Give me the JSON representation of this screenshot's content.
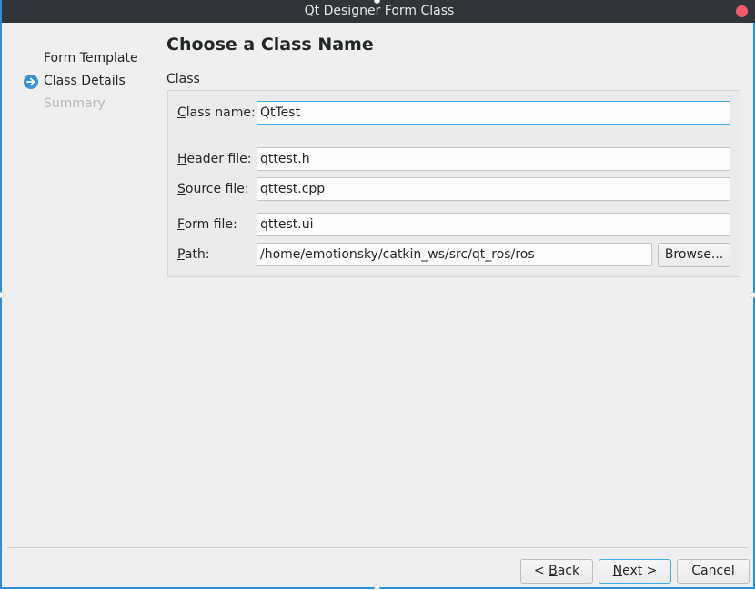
{
  "window": {
    "title": "Qt Designer Form Class"
  },
  "nav": {
    "items": [
      {
        "label": "Form Template",
        "state": "done"
      },
      {
        "label": "Class Details",
        "state": "current"
      },
      {
        "label": "Summary",
        "state": "pending"
      }
    ],
    "current_icon": "arrow-right-circle-icon"
  },
  "page": {
    "title": "Choose a Class Name",
    "group_title": "Class"
  },
  "form": {
    "class_name": {
      "label_mn": "C",
      "label_rest": "lass name:",
      "value": "QtTest"
    },
    "header_file": {
      "label_mn": "H",
      "label_rest": "eader file:",
      "value": "qttest.h"
    },
    "source_file": {
      "label_mn": "S",
      "label_rest": "ource file:",
      "value": "qttest.cpp"
    },
    "form_file": {
      "label_mn": "F",
      "label_rest": "orm file:",
      "value": "qttest.ui"
    },
    "path": {
      "label_mn": "P",
      "label_rest": "ath:",
      "value": "/home/emotionsky/catkin_ws/src/qt_ros/ros"
    },
    "browse_label": "Browse..."
  },
  "buttons": {
    "back_pre": "< ",
    "back_mn": "B",
    "back_rest": "ack",
    "next_mn": "N",
    "next_rest": "ext >",
    "cancel_label": "Cancel"
  },
  "colors": {
    "titlebar": "#313438",
    "accent": "#3daee9",
    "close": "#ef5b6c"
  }
}
